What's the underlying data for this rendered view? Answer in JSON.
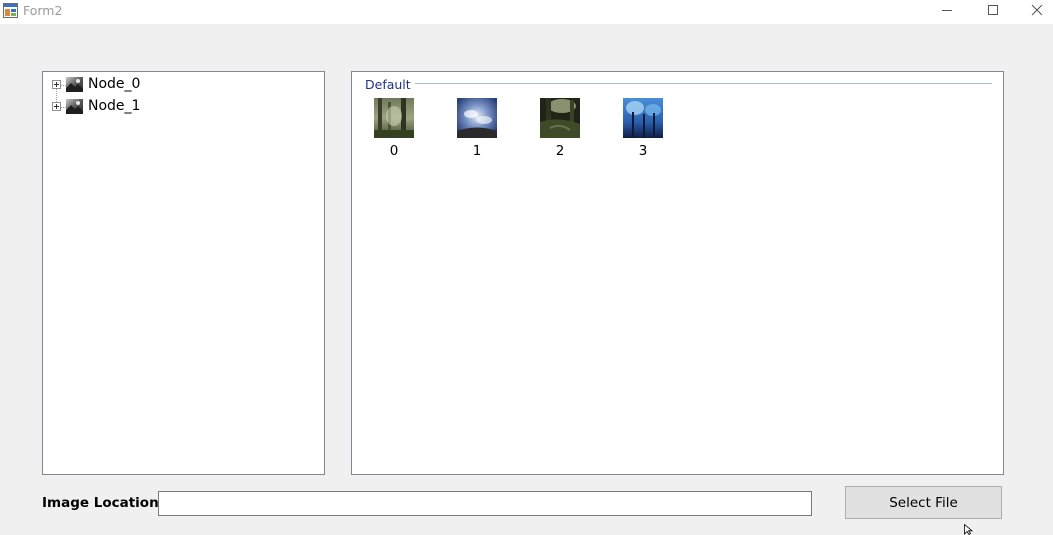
{
  "window": {
    "title": "Form2",
    "icon": "form-app-icon",
    "controls": [
      "minimize-icon",
      "maximize-icon",
      "close-icon"
    ]
  },
  "tree": {
    "nodes": [
      {
        "label": "Node_0",
        "expander": "plus-box-icon",
        "icon": "image-thumbnail-icon"
      },
      {
        "label": "Node_1",
        "expander": "plus-box-icon",
        "icon": "image-thumbnail-icon"
      }
    ]
  },
  "list": {
    "group": "Default",
    "items": [
      {
        "label": "0",
        "thumbnail": "forest-photo"
      },
      {
        "label": "1",
        "thumbnail": "sky-fisheye-photo"
      },
      {
        "label": "2",
        "thumbnail": "dark-forest-photo"
      },
      {
        "label": "3",
        "thumbnail": "blue-forest-photo"
      }
    ]
  },
  "image_location": {
    "label": "Image Location",
    "value": "",
    "placeholder": ""
  },
  "select_button": {
    "label": "Select File"
  },
  "colors": {
    "background": "#f0f0f0",
    "group_header": "#1e3287",
    "group_line": "#a6bbd5",
    "button_face": "#e1e1e1",
    "border": "#828790"
  }
}
